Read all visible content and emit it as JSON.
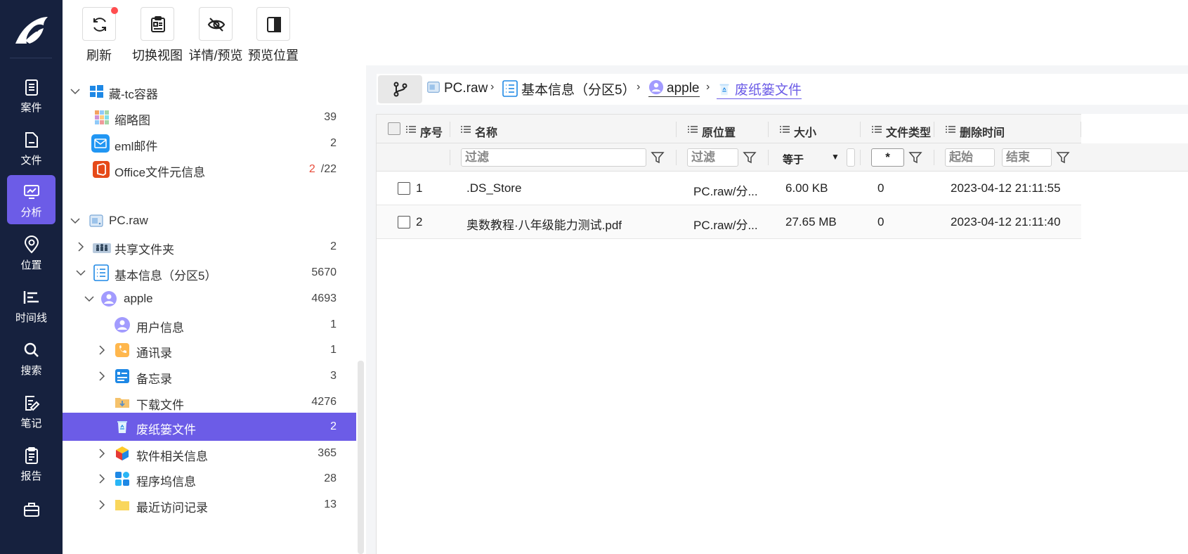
{
  "toolbar": {
    "refresh": "刷新",
    "switch_view": "切换视图",
    "detail_preview": "详情/预览",
    "preview_position": "预览位置"
  },
  "rail": {
    "items": [
      "案件",
      "文件",
      "分析",
      "位置",
      "时间线",
      "搜索",
      "笔记",
      "报告"
    ],
    "active": "分析"
  },
  "tree": {
    "group1": {
      "label": "藏-tc容器",
      "children": [
        {
          "label": "缩略图",
          "count": "39"
        },
        {
          "label": "eml邮件",
          "count": "2"
        },
        {
          "label": "Office文件元信息",
          "count_red": "2",
          "count": "/22"
        }
      ]
    },
    "group2": {
      "label": "PC.raw",
      "children": [
        {
          "label": "共享文件夹",
          "count": "2"
        },
        {
          "label": "基本信息（分区5）",
          "count": "5670"
        },
        {
          "label": "apple",
          "count": "4693"
        },
        {
          "label": "用户信息",
          "count": "1"
        },
        {
          "label": "通讯录",
          "count": "1"
        },
        {
          "label": "备忘录",
          "count": "3"
        },
        {
          "label": "下载文件",
          "count": "4276"
        },
        {
          "label": "废纸篓文件",
          "count": "2"
        },
        {
          "label": "软件相关信息",
          "count": "365"
        },
        {
          "label": "程序坞信息",
          "count": "28"
        },
        {
          "label": "最近访问记录",
          "count": "13"
        }
      ]
    }
  },
  "breadcrumb": {
    "items": [
      "PC.raw",
      "基本信息（分区5）",
      "apple",
      "废纸篓文件"
    ]
  },
  "table": {
    "columns": [
      "序号",
      "名称",
      "原位置",
      "大小",
      "文件类型",
      "删除时间"
    ],
    "filter": {
      "name_placeholder": "过滤",
      "location_placeholder": "过滤",
      "size_op": "等于",
      "type_value": "*",
      "start": "起始",
      "end": "结束"
    },
    "rows": [
      {
        "index": "1",
        "name": ".DS_Store",
        "location": "PC.raw/分...",
        "size": "6.00 KB",
        "type": "0",
        "deleted": "2023-04-12 21:11:55"
      },
      {
        "index": "2",
        "name": "奥数教程·八年级能力测试.pdf",
        "location": "PC.raw/分...",
        "size": "27.65 MB",
        "type": "0",
        "deleted": "2023-04-12 21:11:40"
      }
    ]
  },
  "colors": {
    "rail_bg": "#16213e",
    "accent": "#6c5ce7",
    "badge_red": "#ff4d4f"
  }
}
